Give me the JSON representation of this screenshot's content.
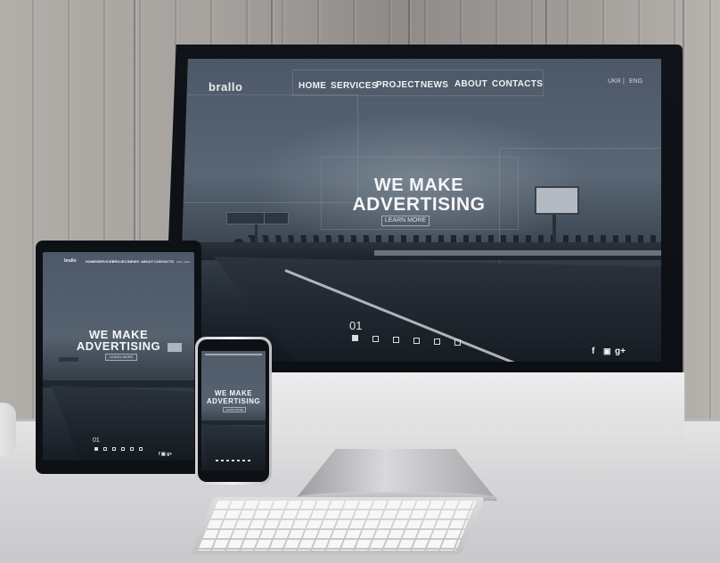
{
  "monitor": {
    "logo": "brallo",
    "nav": [
      "HOME",
      "SERVICES",
      "PROJECT",
      "NEWS",
      "ABOUT",
      "CONTACTS"
    ],
    "lang": {
      "ukr": "UKR",
      "sep": "|",
      "eng": "ENG"
    },
    "hero_line1": "WE MAKE",
    "hero_line2": "ADVERTISING",
    "cta": "LEARN MORE",
    "slide_number": "01",
    "slide_count": 6,
    "active_slide": 1,
    "social": [
      "f",
      "▣",
      "g+"
    ]
  },
  "tablet": {
    "logo": "brallo",
    "nav": [
      "HOME",
      "SERVICES",
      "PROJECT",
      "NEWS",
      "ABOUT",
      "CONTACTS"
    ],
    "lang": "UKR | ENG",
    "hero_line1": "WE MAKE",
    "hero_line2": "ADVERTISING",
    "cta": "LEARN MORE",
    "slide_number": "01",
    "social": "f ▣ g+"
  },
  "phone": {
    "hero_line1": "WE MAKE",
    "hero_line2": "ADVERTISING",
    "cta": "LEARN MORE"
  }
}
